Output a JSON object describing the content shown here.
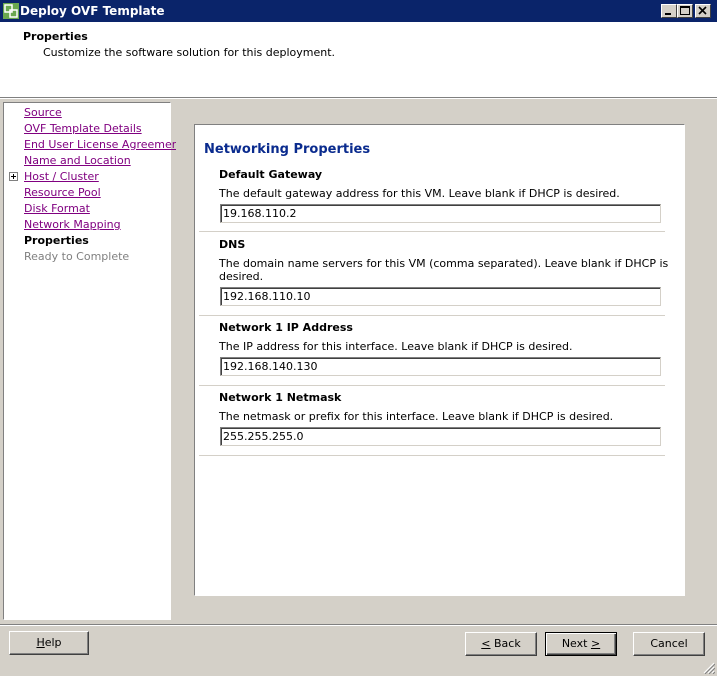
{
  "window": {
    "title": "Deploy OVF Template"
  },
  "header": {
    "title": "Properties",
    "subtitle": "Customize the software solution for this deployment."
  },
  "nav": {
    "items": [
      {
        "label": "Source",
        "state": "link"
      },
      {
        "label": "OVF Template Details",
        "state": "link"
      },
      {
        "label": "End User License Agreement",
        "state": "link"
      },
      {
        "label": "Name and Location",
        "state": "link"
      },
      {
        "label": "Host / Cluster",
        "state": "link",
        "expandable": true
      },
      {
        "label": "Resource Pool",
        "state": "link"
      },
      {
        "label": "Disk Format",
        "state": "link"
      },
      {
        "label": "Network Mapping",
        "state": "link"
      },
      {
        "label": "Properties",
        "state": "current"
      },
      {
        "label": "Ready to Complete",
        "state": "disabled"
      }
    ]
  },
  "main": {
    "section_title": "Networking Properties",
    "properties": [
      {
        "label": "Default Gateway",
        "description": "The default gateway address for this VM. Leave blank if DHCP is desired.",
        "value": "19.168.110.2"
      },
      {
        "label": "DNS",
        "description": "The domain name servers for this VM (comma separated). Leave blank if DHCP is desired.",
        "value": "192.168.110.10"
      },
      {
        "label": "Network 1 IP Address",
        "description": "The IP address for this interface. Leave blank if DHCP is desired.",
        "value": "192.168.140.130"
      },
      {
        "label": "Network 1 Netmask",
        "description": "The netmask or prefix for this interface. Leave blank if DHCP is desired.",
        "value": "255.255.255.0"
      }
    ]
  },
  "buttons": {
    "help": {
      "mnemonic": "H",
      "rest": "elp"
    },
    "back": {
      "prefix": "",
      "mnemonic": "<",
      "rest": " Back"
    },
    "next": {
      "prefix": "Next ",
      "mnemonic": ">",
      "rest": ""
    },
    "cancel": "Cancel"
  },
  "colors": {
    "titlebar": "#0a246a",
    "section_title": "#0a2b8e",
    "visited_link": "#800080",
    "chrome": "#d4d0c8"
  }
}
